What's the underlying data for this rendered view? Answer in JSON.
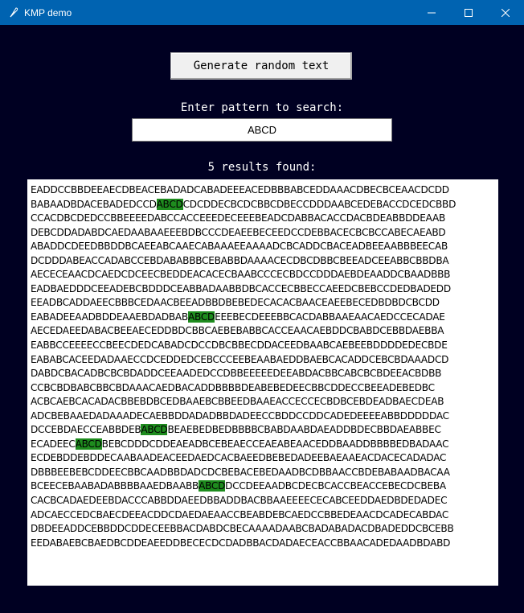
{
  "window": {
    "title": "KMP demo",
    "icon": "feather-icon"
  },
  "controls": {
    "generate_label": "Generate random text",
    "pattern_prompt": "Enter pattern to search:",
    "pattern_value": "ABCD",
    "results_text": "5 results found:"
  },
  "colors": {
    "background": "#000022",
    "titlebar": "#0063b1",
    "highlight": "#1e8c1e"
  },
  "text_lines": [
    [
      "EADDCCBBDEEAECDBEACEBADADCABADEEEACEDBBBABCEDDAAACDBECBCEAACDCDD"
    ],
    [
      "BABAADBDACEBADEDCCD",
      "ABCD",
      "CDCDDECBCDCBBCDBECCDDDAABCEDEBACCDCEDCBBD"
    ],
    [
      "CCACDBCDEDCCBBEEEEDABCCACCEEEDECEEEBEADCDABBACACCDACBDEABBDDEAAB"
    ],
    [
      "DEBCDDADABDCAEDAABAAEEEBDBCCCDEAEEBECEEDCCDEBBACECBCBCCABECAEABD"
    ],
    [
      "ABADDCDEEDBBDDBCAEEABCAAECABAAAEEAAAADCBCADDCBACEADBEEAABBBEECAB"
    ],
    [
      "DCDDDABEACCADABCCEBDABABBBCEBABBDAAAACECDBCDBBCBEEADCEEABBCBBDBA"
    ],
    [
      "AECECEAACDCAEDCDCEECBEDDEACACECBAABCCCECBDCCDDDAEBDEAADDCBAADBBB"
    ],
    [
      "EADBAEDDDCEEADEBCBDDDCEABBADAABBDBCACCECBBECCAEEDCBEBCCDEDBADEDD"
    ],
    [
      "EEADBCADDAEECBBBCEDAACBEEADBBDBEBEDECACACBAACEAEEBECEDBDBDCBCDD"
    ],
    [
      "EABADEEAADBDDEAAEBDADBAB",
      "ABCD",
      "EEEBECDEEEBBCACDABBAAEAACAEDCCECADAE"
    ],
    [
      "AECEDAEEDABACBEEAECEDDBDCBBCAEBEBABBCACCEAACAEBDDCBABDCEBBDAEBBA"
    ],
    [
      "EABBCCEEEECCBEECDEDCABADCDCCDBCBBECDDACEEDBAABCAEBEEBDDDDEDECBDE"
    ],
    [
      "EABABCACEEDADAAECCDCEDDEDCEBCCCEEBEAABAEDDBAEBCACADDCEBCBDAAADCD"
    ],
    [
      "DABDCBACADBCBCBDADDCEEAADEDCCDBBEEEEEDEEABDACBBCABCBCBDEEACBDBB"
    ],
    [
      "CCBCBDBABCBBCBDAAACAEDBACADDBBBBDEABEBEDEECBBCDDECCBEEADEBEDBC"
    ],
    [
      "ACBCAEBCACADACBBEBDBCEDBAAEBCBBEEDBAAEACCECCECBDBCEBDEADBAECDEAB"
    ],
    [
      "ADCBEBAAEDADAAADECAEBBDDADADBBDADEECCBDDCCDDCADEDEEEEABBDDDDDAC"
    ],
    [
      "DCCEBDAECCEABBDEB",
      "ABCD",
      "BEAEBEDBEDBBBBCBABDAABDAEADDBDECBBDAEABBEC"
    ],
    [
      "ECADEEC",
      "ABCD",
      "BEBCDDDCDDEAEADBCEBEAECCEAEABEAACEDDBAADDBBBBEDBADAAC"
    ],
    [
      "ECDEBDDEBDDECAABAADEACEEDAEDCACBAEEDBEBEDADEEBAEAAEACDACECADADAC"
    ],
    [
      "DBBBEEBEBCDDEECBBCAADBBDADCDCBEBACEBEDAADBCDBBAACCBDEBABAADBACAA"
    ],
    [
      "BCEECEBAABADABBBBAAEDBAABB",
      "ABCD",
      "DCCDEEAADBCDECBCACCBEACCEBECDCBEBA"
    ],
    [
      "CACBCADAEDEEBDACCCABBDDAEEDBBADDBACBBAAEEEECECABCEEDDAEDBDEDADEC"
    ],
    [
      "ADCAECCEDCBAECDEEACDDCDAEDAEAACCBEABDEBCAEDCCBBEDEAACDCADECABDAC"
    ],
    [
      "DBDEEADDCEBBDDCDDECEEBBACDABDCBECAAAADAABCBADABADACDBADEDDCBCEBB"
    ],
    [
      "EEDABAEBCBAEDBCDDEAEEDDBECECDCDADBBACDADAECEACCBBAACADEDAADBDABD"
    ]
  ]
}
